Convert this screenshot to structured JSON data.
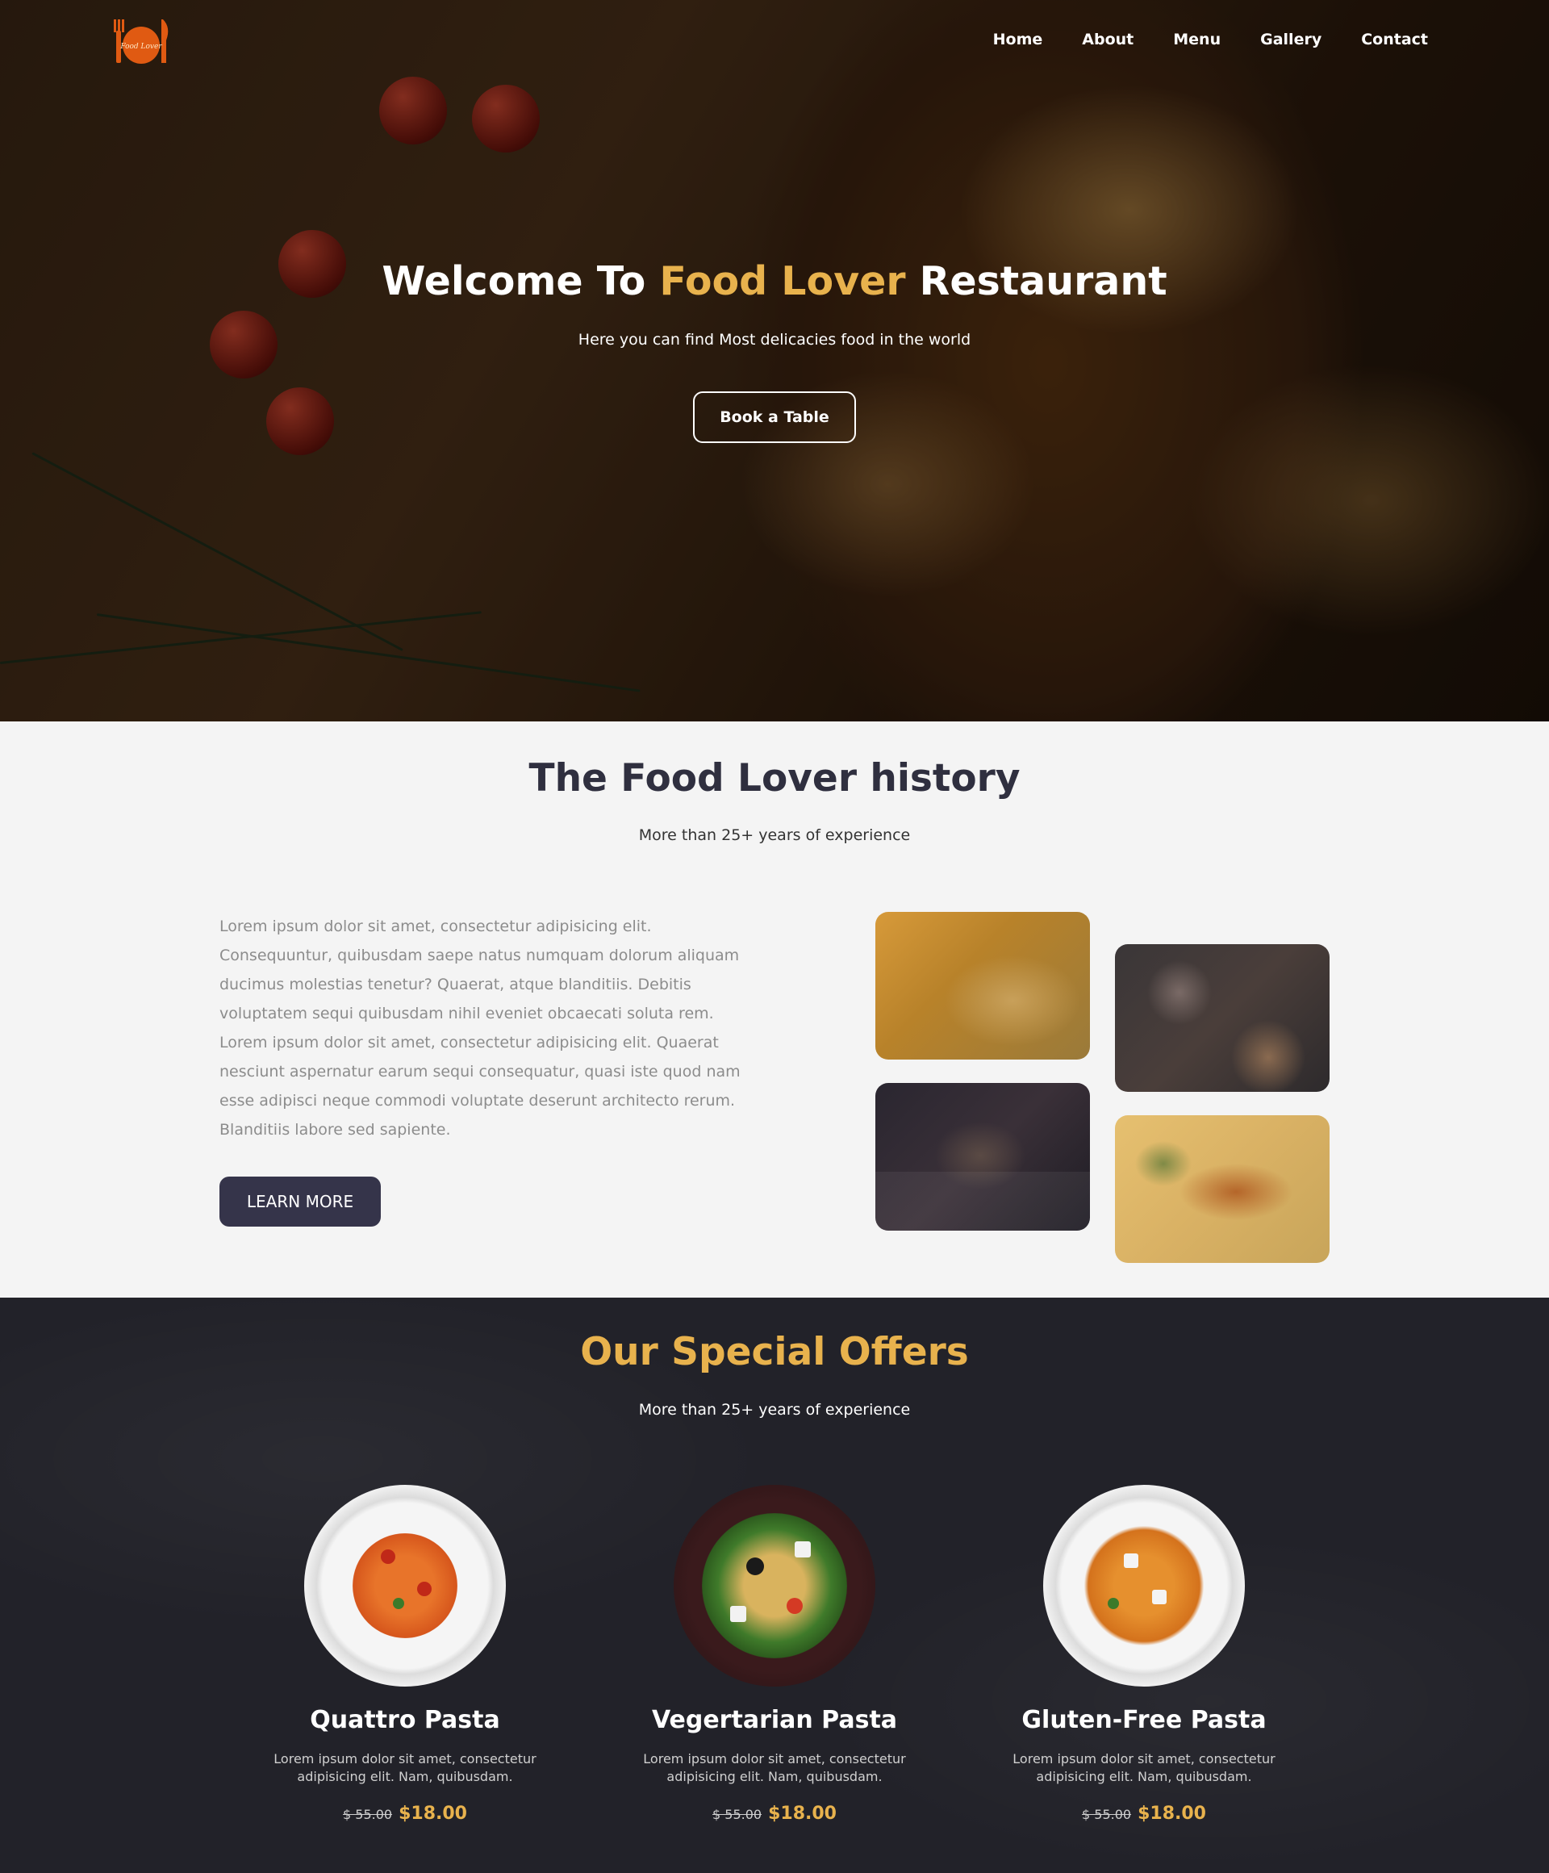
{
  "colors": {
    "accent": "#e8b24d",
    "dark": "#35344a",
    "offers_bg": "#222229"
  },
  "brand": {
    "logo_text": "Food Lover"
  },
  "nav": {
    "items": [
      "Home",
      "About",
      "Menu",
      "Gallery",
      "Contact"
    ]
  },
  "hero": {
    "title_pre": "Welcome To ",
    "title_accent": "Food Lover",
    "title_post": " Restaurant",
    "subtitle": "Here you can find Most delicacies food in the world",
    "cta_label": "Book a Table"
  },
  "history": {
    "title": "The Food Lover history",
    "subtitle": "More than 25+ years of experience",
    "body": "Lorem ipsum dolor sit amet, consectetur adipisicing elit. Consequuntur, quibusdam saepe natus numquam dolorum aliquam ducimus molestias tenetur? Quaerat, atque blanditiis. Debitis voluptatem sequi quibusdam nihil eveniet obcaecati soluta rem. Lorem ipsum dolor sit amet, consectetur adipisicing elit. Quaerat nesciunt aspernatur earum sequi consequatur, quasi iste quod nam esse adipisci neque commodi voluptate deserunt architecto rerum. Blanditiis labore sed sapiente.",
    "button_label": "LEARN MORE"
  },
  "offers": {
    "title": "Our Special Offers",
    "subtitle": "More than 25+ years of experience",
    "items": [
      {
        "name": "Quattro Pasta",
        "desc": "Lorem ipsum dolor sit amet, consectetur adipisicing elit. Nam, quibusdam.",
        "old_price": "$ 55.00",
        "price": "$18.00"
      },
      {
        "name": "Vegertarian Pasta",
        "desc": "Lorem ipsum dolor sit amet, consectetur adipisicing elit. Nam, quibusdam.",
        "old_price": "$ 55.00",
        "price": "$18.00"
      },
      {
        "name": "Gluten-Free Pasta",
        "desc": "Lorem ipsum dolor sit amet, consectetur adipisicing elit. Nam, quibusdam.",
        "old_price": "$ 55.00",
        "price": "$18.00"
      }
    ]
  }
}
